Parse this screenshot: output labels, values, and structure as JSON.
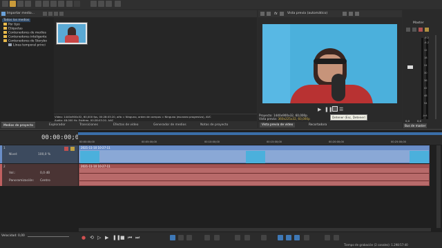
{
  "explorer": {
    "title": "Importar medio...",
    "tree": [
      {
        "label": "Todos los medios",
        "selected": true
      },
      {
        "label": "Por tipo"
      },
      {
        "label": "Etiquetas"
      },
      {
        "label": "Contenedores de medios"
      },
      {
        "label": "Contenedores inteligente"
      },
      {
        "label": "Contenedores de Storybo"
      },
      {
        "label": "Línea temporal princi"
      }
    ],
    "media_info_line1": "Vídeo: 1440x900x32, 60,000 fps, 00:28:03:20, alfa = Ninguno, orden de campos = Ninguno (escaneo progresivo), AVC",
    "media_info_line2": "Audio: 48.000 Hz, Estéreo, 00:28:03:20, AAC"
  },
  "bottom_tabs_left": [
    "Medios de proyecto",
    "Explorador",
    "Transiciones",
    "Efectos de vídeo",
    "Generador de medios",
    "Notas de proyecto"
  ],
  "preview": {
    "mode": "Vista previa (automático)",
    "project_label": "Proyecto:",
    "project_value": "1440x900x32, 60,000p",
    "preview_label": "Vista previa:",
    "preview_value": "360x225x32, 60,000p",
    "tooltip": "Detener (Esc, Detener)",
    "tabs": [
      "Vista previa de vídeo",
      "Recortadora"
    ]
  },
  "master": {
    "title": "Master",
    "scale": [
      "-6.2",
      "-6.2",
      "12",
      "18",
      "24",
      "30",
      "36",
      "42",
      "48",
      "54",
      "-Inf."
    ],
    "value_left": "0,0",
    "value_right": "0,0",
    "tab": "Bus de master"
  },
  "timeline": {
    "timecode": "00:00:00;00",
    "ruler": [
      "00:00:00;00",
      "00:05:00;00",
      "00:10:00;00",
      "00:15:00;00",
      "00:20:00;00",
      "00:25:00;00"
    ],
    "video_track": {
      "number": "1",
      "level_label": "Nivel:",
      "level_value": "100,0 %",
      "clip_name": "2021-11-10 10-27-11"
    },
    "audio_track": {
      "number": "2",
      "vol_label": "Vol.:",
      "vol_value": "0,0 dB",
      "pan_label": "Panoramización:",
      "pan_value": "Centro",
      "clip_name": "2021-11-10 10-27-11"
    },
    "rate_label": "Velocidad: 0,00",
    "status": "Tiempo de grabación (2 canales): 1.298:57:40"
  },
  "colors": {
    "accent": "#4a8fd6",
    "video_track": "#8aa8d6",
    "audio_track": "#b86a6a",
    "folder": "#e8b94a"
  }
}
